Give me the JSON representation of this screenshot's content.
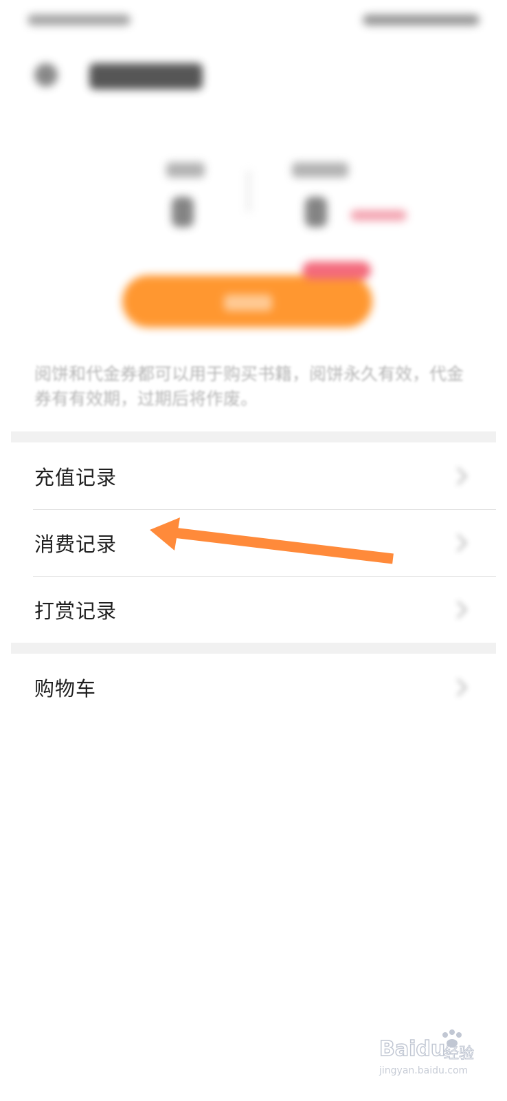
{
  "description_text": "阅饼和代金券都可以用于购买书籍，阅饼永久有效，代金券有有效期，过期后将作废。",
  "menu": {
    "group1": [
      {
        "label": "充值记录"
      },
      {
        "label": "消费记录"
      },
      {
        "label": "打赏记录"
      }
    ],
    "group2": [
      {
        "label": "购物车"
      }
    ]
  },
  "annotation": {
    "color": "#ff8a3a",
    "points_to": "消费记录"
  },
  "watermark": {
    "brand": "Baidu经验",
    "url": "jingyan.baidu.com"
  },
  "colors": {
    "primary_button": "#ff8c1a",
    "tag_red": "#f25b6e"
  }
}
